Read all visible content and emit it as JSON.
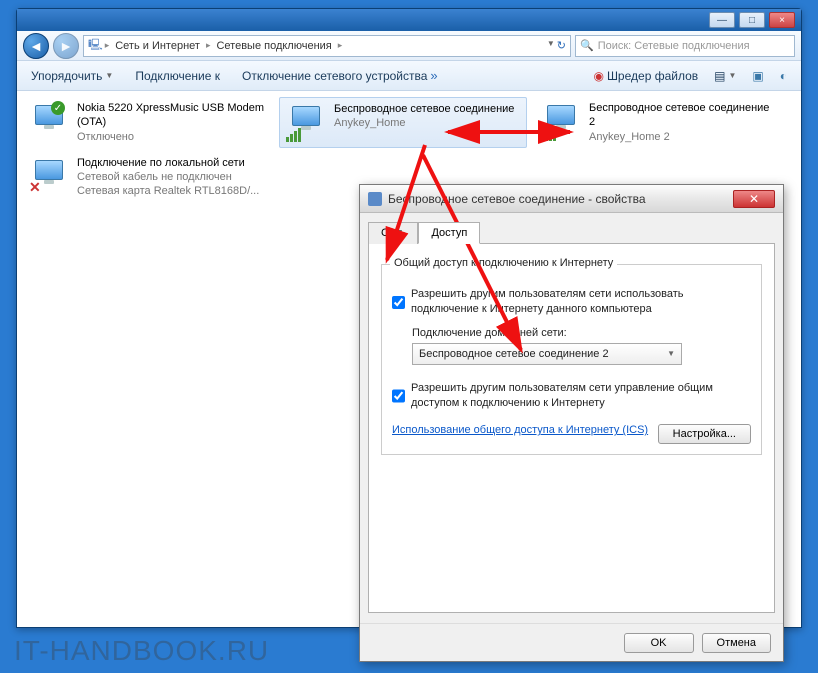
{
  "windowControls": {
    "min": "—",
    "max": "□",
    "close": "×"
  },
  "breadcrumb": {
    "seg1": "Сеть и Интернет",
    "seg2": "Сетевые подключения"
  },
  "search": {
    "placeholder": "Поиск: Сетевые подключения"
  },
  "toolbar": {
    "organize": "Упорядочить",
    "connectTo": "Подключение к",
    "disableDevice": "Отключение сетевого устройства",
    "shredder": "Шредер файлов"
  },
  "connections": [
    {
      "title": "Nokia 5220 XpressMusic USB Modem (OTA)",
      "sub1": "Отключено",
      "sub2": ""
    },
    {
      "title": "Беспроводное сетевое соединение",
      "sub1": "Anykey_Home",
      "sub2": ""
    },
    {
      "title": "Беспроводное сетевое соединение 2",
      "sub1": "Anykey_Home 2",
      "sub2": ""
    },
    {
      "title": "Подключение по локальной сети",
      "sub1": "Сетевой кабель не подключен",
      "sub2": "Сетевая карта Realtek RTL8168D/..."
    }
  ],
  "dialog": {
    "title": "Беспроводное сетевое соединение - свойства",
    "tabs": {
      "network": "Сеть",
      "sharing": "Доступ"
    },
    "group": "Общий доступ к подключению к Интернету",
    "chk1": "Разрешить другим пользователям сети использовать подключение к Интернету данного компьютера",
    "homenetLabel": "Подключение домашней сети:",
    "homenetValue": "Беспроводное сетевое соединение 2",
    "chk2": "Разрешить другим пользователям сети управление общим доступом к подключению к Интернету",
    "icsLink": "Использование общего доступа к Интернету (ICS)",
    "settings": "Настройка...",
    "ok": "OK",
    "cancel": "Отмена"
  },
  "watermark": "IT-HANDBOOK.RU"
}
